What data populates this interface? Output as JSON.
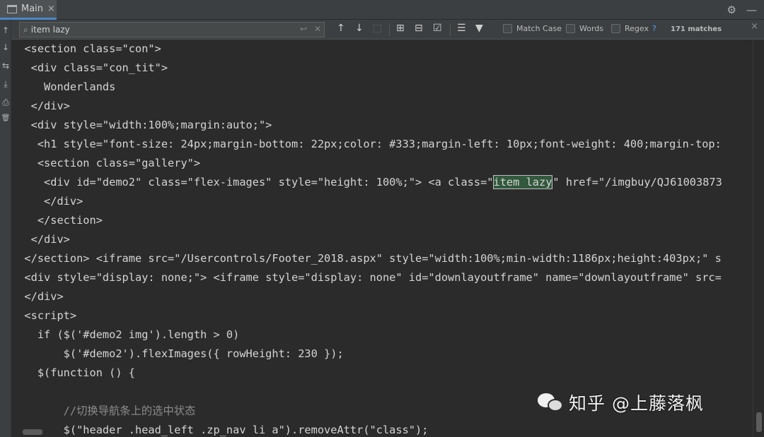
{
  "tab": {
    "label": "Main",
    "close": "×"
  },
  "tabbar_right": {
    "settings": "⚙",
    "minimize": "—"
  },
  "gutter": {
    "icons": [
      "↑",
      "↓",
      "⇆",
      "⤓",
      "⎙",
      "🗑"
    ]
  },
  "find": {
    "query": "item lazy",
    "match_case": "Match Case",
    "words": "Words",
    "regex": "Regex",
    "regex_help": "?",
    "matches": "171 matches",
    "close": "×"
  },
  "code": [
    "  <section class=\"con\">",
    "   <div class=\"con_tit\">",
    "     Wonderlands",
    "   </div>",
    "   <div style=\"width:100%;margin:auto;\">",
    "    <h1 style=\"font-size: 24px;margin-bottom: 22px;color: #333;margin-left: 10px;font-weight: 400;margin-top:",
    "    <section class=\"gallery\">",
    {
      "pre": "     <div id=\"demo2\" class=\"flex-images\" style=\"height: 100%;\"> <a class=\"",
      "match": "item lazy",
      "post": "\" href=\"/imgbuy/QJ61003873"
    },
    "     </div>",
    "    </section>",
    "   </div>",
    "  </section> <iframe src=\"/Usercontrols/Footer_2018.aspx\" style=\"width:100%;min-width:1186px;height:403px;\" s",
    "  <div style=\"display: none;\"> <iframe style=\"display: none\" id=\"downlayoutframe\" name=\"downlayoutframe\" src=",
    "  </div>",
    "  <script>",
    "    if ($('#demo2 img').length > 0)",
    "        $('#demo2').flexImages({ rowHeight: 230 });",
    "    $(function () {",
    "",
    "        //切换导航条上的选中状态",
    "        $(\"header .head_left .zp_nav li a\").removeAttr(\"class\");"
  ],
  "watermark": {
    "text": "知乎 @上藤落枫"
  }
}
